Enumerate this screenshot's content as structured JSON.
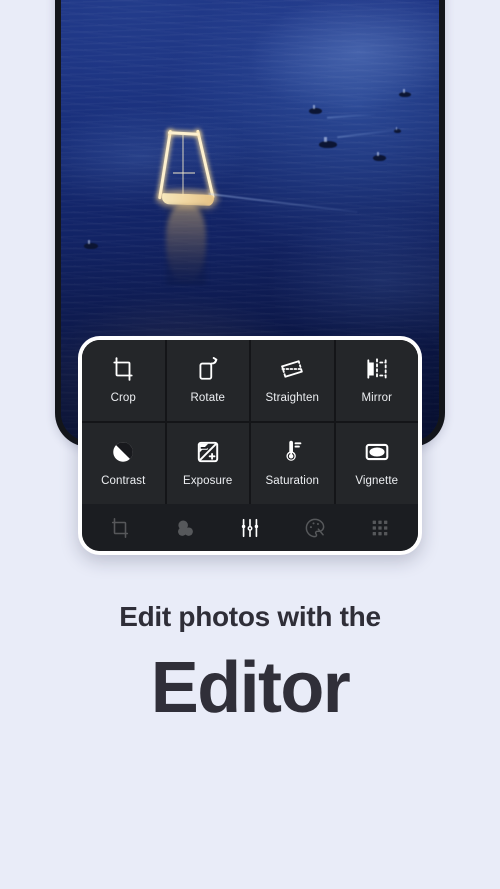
{
  "theme": {
    "background": "#e9ecf8",
    "panel_border": "#ffffff",
    "panel_bg": "#1f2125",
    "tool_cell_bg": "#242629",
    "toolbar_bg": "#1b1d21",
    "label_color": "#eceef1",
    "heading_color": "#302f39"
  },
  "photo": {
    "description": "Sailboat with illuminated mast at dusk on deep blue sea",
    "alt": "sailboat-photo"
  },
  "editor": {
    "tools": [
      {
        "icon": "crop-icon",
        "label": "Crop"
      },
      {
        "icon": "rotate-icon",
        "label": "Rotate"
      },
      {
        "icon": "straighten-icon",
        "label": "Straighten"
      },
      {
        "icon": "mirror-icon",
        "label": "Mirror"
      },
      {
        "icon": "contrast-icon",
        "label": "Contrast"
      },
      {
        "icon": "exposure-icon",
        "label": "Exposure"
      },
      {
        "icon": "saturation-icon",
        "label": "Saturation"
      },
      {
        "icon": "vignette-icon",
        "label": "Vignette"
      }
    ],
    "toolbar": [
      {
        "icon": "crop-tab-icon",
        "name": "crop",
        "active": false
      },
      {
        "icon": "filters-tab-icon",
        "name": "filters",
        "active": false
      },
      {
        "icon": "adjust-sliders-tab-icon",
        "name": "adjust",
        "active": true
      },
      {
        "icon": "effects-palette-tab-icon",
        "name": "effects",
        "active": false
      },
      {
        "icon": "grid-tab-icon",
        "name": "more",
        "active": false
      }
    ]
  },
  "caption": {
    "line1": "Edit photos with the",
    "line2": "Editor"
  }
}
